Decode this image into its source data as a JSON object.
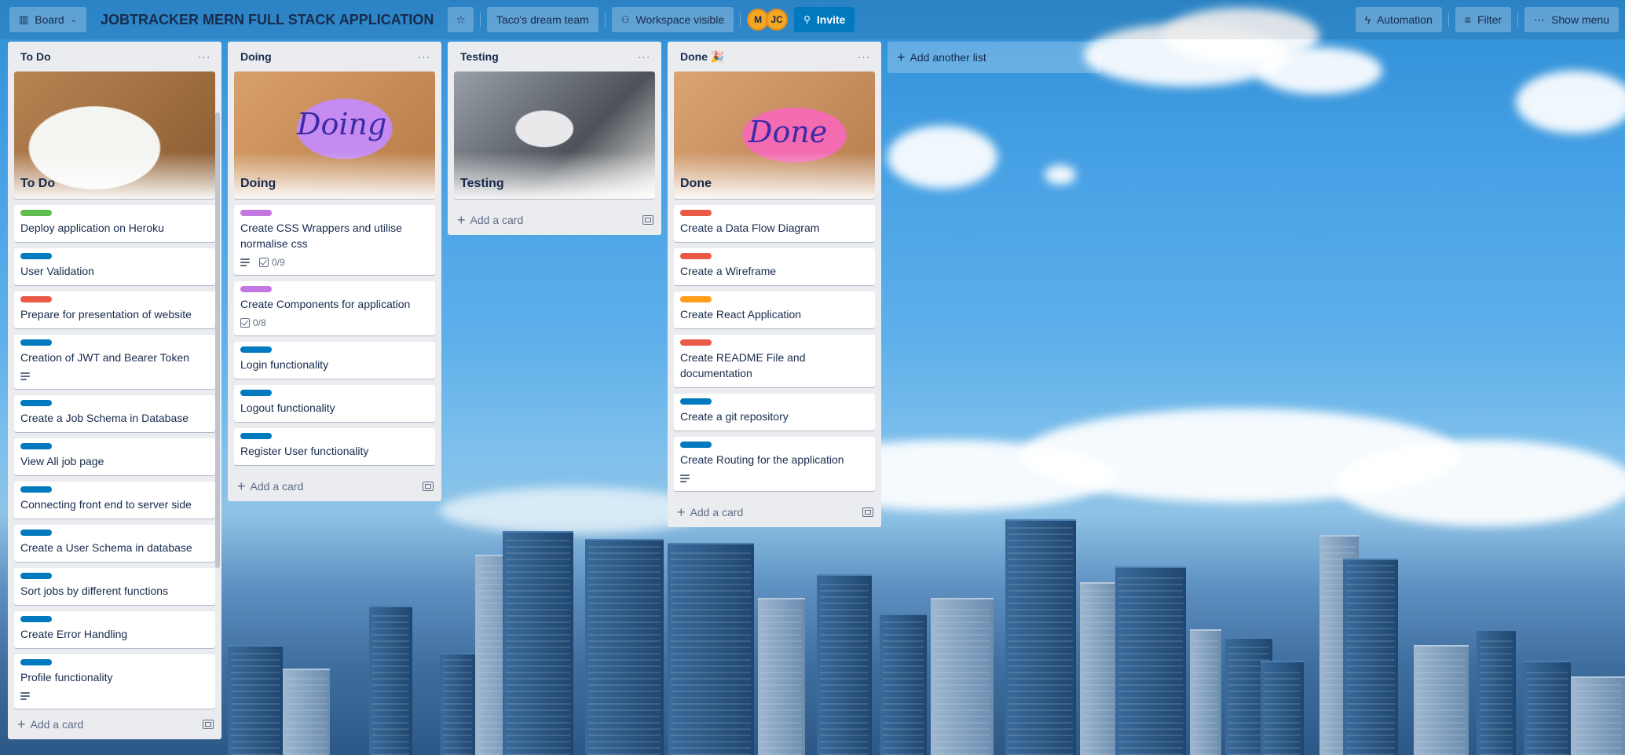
{
  "header": {
    "view_label": "Board",
    "board_title": "JOBTRACKER MERN FULL STACK APPLICATION",
    "workspace_name": "Taco's dream team",
    "visibility_label": "Workspace visible",
    "members": [
      {
        "initials": "M"
      },
      {
        "initials": "JC"
      }
    ],
    "invite_label": "Invite",
    "automation_label": "Automation",
    "filter_label": "Filter",
    "show_menu_label": "Show menu"
  },
  "colors": {
    "green": "#61bd4f",
    "blue": "#0079bf",
    "red": "#eb5a46",
    "purple": "#c377e0",
    "orange": "#ff9f1a",
    "list_bg": "#ebecf0"
  },
  "lists": [
    {
      "title": "To Do",
      "cover_title": "To Do",
      "cover_art": "",
      "cards": [
        {
          "label": "green",
          "text": "Deploy application on Heroku"
        },
        {
          "label": "blue",
          "text": "User Validation"
        },
        {
          "label": "red",
          "text": "Prepare for presentation of website"
        },
        {
          "label": "blue",
          "text": "Creation of JWT and Bearer Token",
          "has_description": true
        },
        {
          "label": "blue",
          "text": "Create a Job Schema in Database"
        },
        {
          "label": "blue",
          "text": "View All job page"
        },
        {
          "label": "blue",
          "text": "Connecting front end to server side"
        },
        {
          "label": "blue",
          "text": "Create a User Schema in database"
        },
        {
          "label": "blue",
          "text": "Sort jobs by different functions"
        },
        {
          "label": "blue",
          "text": "Create Error Handling"
        },
        {
          "label": "blue",
          "text": "Profile functionality",
          "has_description": true
        },
        {
          "label": "blue",
          "text": ""
        }
      ],
      "add_card_label": "Add a card"
    },
    {
      "title": "Doing",
      "cover_title": "Doing",
      "cover_art": "Doing",
      "cards": [
        {
          "label": "purple",
          "text": "Create CSS Wrappers and utilise normalise css",
          "has_description": true,
          "checklist": "0/9"
        },
        {
          "label": "purple",
          "text": "Create Components for application",
          "checklist": "0/8"
        },
        {
          "label": "blue",
          "text": "Login functionality"
        },
        {
          "label": "blue",
          "text": "Logout functionality"
        },
        {
          "label": "blue",
          "text": "Register User functionality"
        }
      ],
      "add_card_label": "Add a card"
    },
    {
      "title": "Testing",
      "cover_title": "Testing",
      "cover_art": "",
      "cards": [],
      "add_card_label": "Add a card"
    },
    {
      "title": "Done 🎉",
      "cover_title": "Done",
      "cover_art": "Done",
      "cards": [
        {
          "label": "red",
          "text": "Create a Data Flow Diagram"
        },
        {
          "label": "red",
          "text": "Create a Wireframe"
        },
        {
          "label": "orange",
          "text": "Create React Application"
        },
        {
          "label": "red",
          "text": "Create README File and documentation"
        },
        {
          "label": "blue",
          "text": "Create a git repository"
        },
        {
          "label": "blue",
          "text": "Create Routing for the application",
          "has_description": true
        }
      ],
      "add_card_label": "Add a card"
    }
  ],
  "add_list_label": "Add another list"
}
